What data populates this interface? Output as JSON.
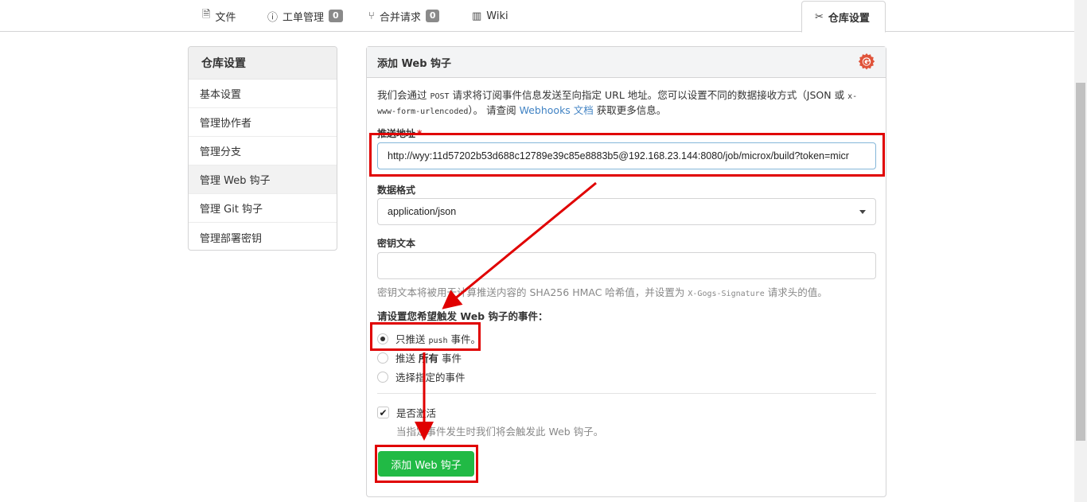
{
  "tabs": [
    {
      "label": "文件",
      "icon": "file-icon",
      "glyph": "🗎"
    },
    {
      "label": "工单管理",
      "icon": "issue-icon",
      "glyph": "ⓘ",
      "count": "0"
    },
    {
      "label": "合并请求",
      "icon": "pull-request-icon",
      "glyph": "⑂",
      "count": "0"
    },
    {
      "label": "Wiki",
      "icon": "book-icon",
      "glyph": "▥"
    },
    {
      "label": "仓库设置",
      "icon": "tools-icon",
      "glyph": "✂",
      "active": true
    }
  ],
  "sidebar": {
    "header": "仓库设置",
    "items": [
      {
        "label": "基本设置"
      },
      {
        "label": "管理协作者"
      },
      {
        "label": "管理分支"
      },
      {
        "label": "管理 Web 钩子",
        "active": true
      },
      {
        "label": "管理 Git 钩子"
      },
      {
        "label": "管理部署密钥"
      }
    ]
  },
  "form": {
    "title": "添加 Web 钩子",
    "desc_1": "我们会通过 ",
    "desc_post": "POST",
    "desc_2": " 请求将订阅事件信息发送至向指定 URL 地址。您可以设置不同的数据接收方式（JSON 或 ",
    "desc_form": "x-www-form-urlencoded",
    "desc_3": "）。 请查阅 ",
    "desc_link": "Webhooks 文档",
    "desc_4": " 获取更多信息。",
    "url_label": "推送地址",
    "url_required": "*",
    "url_value": "http://wyy:11d57202b53d688c12789e39c85e8883b5@192.168.23.144:8080/job/microx/build?token=micr",
    "format_label": "数据格式",
    "format_value": "application/json",
    "secret_label": "密钥文本",
    "secret_value": "",
    "secret_hint_1": "密钥文本将被用于计算推送内容的 SHA256 HMAC 哈希值，并设置为 ",
    "secret_hint_code": "X-Gogs-Signature",
    "secret_hint_2": " 请求头的值。",
    "events_label": "请设置您希望触发 Web 钩子的事件：",
    "event_push_1": "只推送 ",
    "event_push_code": "push",
    "event_push_2": " 事件。",
    "event_all_1": "推送 ",
    "event_all_bold": "所有",
    "event_all_2": " 事件",
    "event_choose": "选择指定的事件",
    "selected_event": "push",
    "active_label": "是否激活",
    "active_checked": true,
    "active_hint": "当指定事件发生时我们将会触发此 Web 钩子。",
    "submit_label": "添加 Web 钩子"
  },
  "colors": {
    "accent_green": "#21ba45",
    "annotation_red": "#e00000",
    "link_blue": "#4183c4",
    "gogs_logo": "#e0533a"
  }
}
